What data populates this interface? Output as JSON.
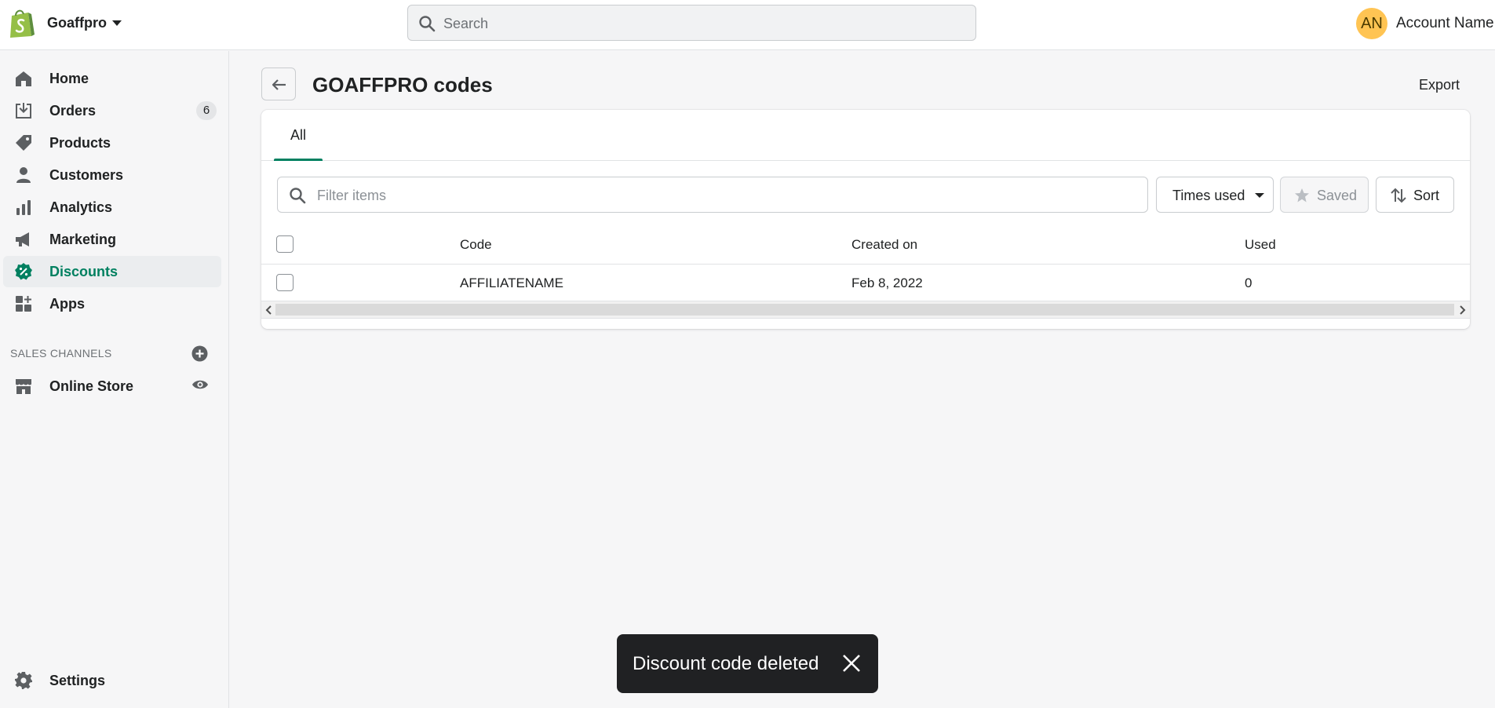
{
  "topbar": {
    "store_name": "Goaffpro",
    "search_placeholder": "Search",
    "avatar_initials": "AN",
    "account_name": "Account Name"
  },
  "sidebar": {
    "items": [
      {
        "label": "Home",
        "icon": "home-icon"
      },
      {
        "label": "Orders",
        "icon": "orders-icon",
        "badge": "6"
      },
      {
        "label": "Products",
        "icon": "tag-icon"
      },
      {
        "label": "Customers",
        "icon": "person-icon"
      },
      {
        "label": "Analytics",
        "icon": "bar-chart-icon"
      },
      {
        "label": "Marketing",
        "icon": "megaphone-icon"
      },
      {
        "label": "Discounts",
        "icon": "discount-icon",
        "active": true
      },
      {
        "label": "Apps",
        "icon": "apps-icon"
      }
    ],
    "sales_channels_title": "SALES CHANNELS",
    "online_store_label": "Online Store",
    "settings_label": "Settings"
  },
  "page": {
    "title": "GOAFFPRO codes",
    "export_label": "Export",
    "tabs": [
      {
        "label": "All",
        "selected": true
      }
    ],
    "filter_placeholder": "Filter items",
    "times_used_label": "Times used",
    "saved_label": "Saved",
    "sort_label": "Sort"
  },
  "table": {
    "columns": [
      "Code",
      "Created on",
      "Used"
    ],
    "rows": [
      {
        "code": "AFFILIATENAME",
        "created_on": "Feb 8, 2022",
        "used": "0"
      }
    ]
  },
  "toast": {
    "message": "Discount code deleted"
  },
  "colors": {
    "accent": "#008060",
    "avatar": "#ffc453",
    "toast_bg": "#202123"
  }
}
